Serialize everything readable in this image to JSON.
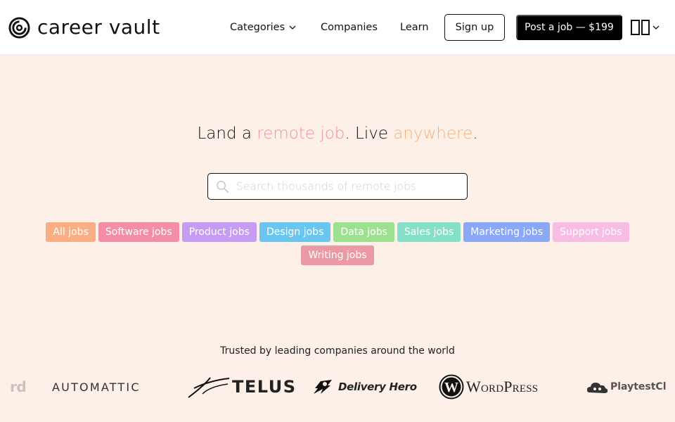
{
  "brand": {
    "name": "career vault"
  },
  "nav": {
    "categories": "Categories",
    "companies": "Companies",
    "learn": "Learn",
    "signup": "Sign up",
    "post_job": "Post a job — $199"
  },
  "hero": {
    "part1": "Land a ",
    "highlight1": "remote job",
    "part2": ". Live ",
    "highlight2": "anywhere",
    "part3": ".",
    "search_placeholder": "Search thousands of remote jobs"
  },
  "tags": [
    {
      "label": "All jobs",
      "color": "#f9ae84"
    },
    {
      "label": "Software jobs",
      "color": "#f28ea5"
    },
    {
      "label": "Product jobs",
      "color": "#c59cf2"
    },
    {
      "label": "Design jobs",
      "color": "#6bc6ef"
    },
    {
      "label": "Data jobs",
      "color": "#9de08f"
    },
    {
      "label": "Sales jobs",
      "color": "#86e0c8"
    },
    {
      "label": "Marketing jobs",
      "color": "#8aa8f5"
    },
    {
      "label": "Support jobs",
      "color": "#f7bde4"
    },
    {
      "label": "Writing jobs",
      "color": "#eb9aa5"
    }
  ],
  "trusted": {
    "text": "Trusted by leading companies around the world",
    "logos": {
      "partial_left": "rd",
      "automattic": "AUTOMATTIC",
      "telus": "TELUS",
      "delivery_hero": "Delivery Hero",
      "wordpress": "WordPress",
      "playtest": "PlaytestCl"
    }
  },
  "colors": {
    "background": "#fdf0e8",
    "accent_pink": "#f291a0",
    "accent_orange": "#f5b07a",
    "cta": "#000000"
  }
}
